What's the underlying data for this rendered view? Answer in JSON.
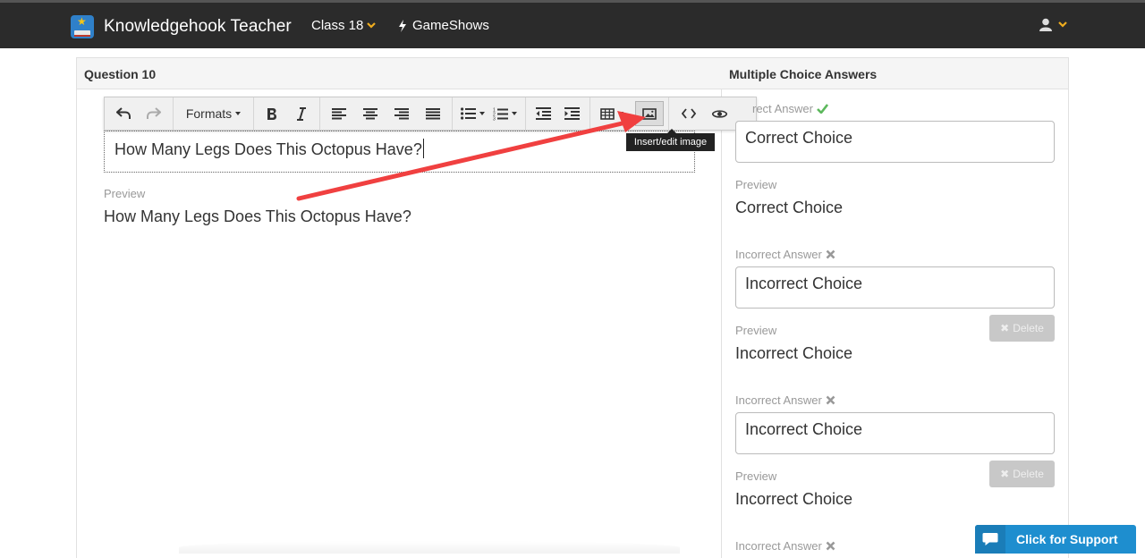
{
  "navbar": {
    "brand_name": "Knowledgehook Teacher",
    "class_label": "Class 18",
    "gameshows_label": "GameShows",
    "accent_color": "#f0ad1e"
  },
  "question_panel": {
    "title": "Question 10",
    "editor_text": "How Many Legs Does This Octopus Have?",
    "preview_label": "Preview",
    "preview_text": "How Many Legs Does This Octopus Have?"
  },
  "toolbar": {
    "formats_label": "Formats",
    "icons": [
      "undo-icon",
      "redo-icon",
      "bold-icon",
      "italic-icon",
      "align-left-icon",
      "align-center-icon",
      "align-right-icon",
      "align-justify-icon",
      "bullet-list-icon",
      "numbered-list-icon",
      "outdent-icon",
      "indent-icon",
      "table-icon",
      "image-icon",
      "code-icon",
      "preview-eye-icon"
    ],
    "tooltip": "Insert/edit image"
  },
  "answers_panel": {
    "title": "Multiple Choice Answers",
    "answers": [
      {
        "label": "rect Answer",
        "value": "Correct Choice",
        "preview_label": "Preview",
        "preview": "Correct Choice"
      },
      {
        "label": "Incorrect Answer",
        "value": "Incorrect Choice",
        "preview_label": "Preview",
        "preview": "Incorrect Choice",
        "delete_label": "Delete"
      },
      {
        "label": "Incorrect Answer",
        "value": "Incorrect Choice",
        "preview_label": "Preview",
        "preview": "Incorrect Choice",
        "delete_label": "Delete"
      },
      {
        "label": "Incorrect Answer"
      }
    ],
    "correct_color": "#5cb85c"
  },
  "support": {
    "label": "Click for Support",
    "color": "#1e8ecf"
  },
  "annotation": {
    "arrow_color": "#f04040"
  }
}
